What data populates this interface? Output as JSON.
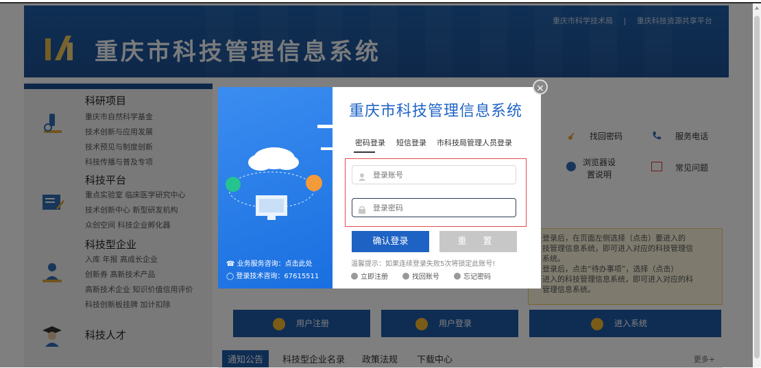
{
  "header": {
    "site_title": "重庆市科技管理信息系统",
    "top_link_1": "重庆市科学技术局",
    "top_separator": "|",
    "top_link_2": "重庆科技资源共享平台"
  },
  "left_menu": {
    "sections": [
      {
        "title": "科研项目",
        "lines": [
          "重庆市自然科学基金",
          "技术创新与应用发展",
          "技术预见与制度创新",
          "科技传播与普及专项"
        ],
        "icon": "microscope-icon"
      },
      {
        "title": "科技平台",
        "lines": [
          "重点实验室 临床医学研究中心",
          "技术创新中心 新型研发机构",
          "众创空间 科技企业孵化器"
        ],
        "icon": "edit-board-icon"
      },
      {
        "title": "科技型企业",
        "lines": [
          "入库 年报 高成长企业",
          "创新券 高新技术产品",
          "高新技术企业 知识价值信用评价",
          "科技创新板挂牌 加计扣除"
        ],
        "icon": "business-people-icon"
      },
      {
        "title": "科技人才",
        "lines": [],
        "icon": "graduate-icon"
      }
    ]
  },
  "right_panel": {
    "items": [
      {
        "label": "找回密码",
        "icon": "key-icon"
      },
      {
        "label": "服务电话",
        "icon": "phone-icon"
      },
      {
        "label": "浏览器设置说明",
        "icon": "browser-icon"
      },
      {
        "label": "常见问题",
        "icon": "faq-icon"
      }
    ]
  },
  "notice": {
    "lines": [
      "登录后，在页面左侧选择（点击）要进入的",
      "技管理信息系统，即可进入对应的科技管理信",
      "系统。",
      "登录后，点击“待办事项”，选择（点击）",
      "进入的科技管理信息系统，即可进入对应的科",
      "管理信息系统。"
    ]
  },
  "steps": [
    "用户注册",
    "用户登录",
    "进入系统"
  ],
  "tabs": {
    "items": [
      "通知公告",
      "科技型企业名录",
      "政策法规",
      "下载中心"
    ],
    "more": "更多+"
  },
  "modal": {
    "title": "重庆市科技管理信息系统",
    "login_tabs": [
      "密码登录",
      "短信登录",
      "市科技局管理人员登录"
    ],
    "account_placeholder": "登录账号",
    "password_placeholder": "登录密码",
    "login_button": "确认登录",
    "reset_button": "重 置",
    "tip": "温馨提示：如果连续登录失败5次将锁定此账号!",
    "links": [
      "立即注册",
      "找回账号",
      "忘记密码"
    ],
    "consult_business": "业务服务咨询：点击此处",
    "consult_tech": "登录技术咨询：67615511",
    "close_symbol": "×"
  },
  "colors": {
    "brand_blue": "#1e63c4",
    "banner_blue": "#1b4f92",
    "highlight_red": "#e34b4b"
  }
}
